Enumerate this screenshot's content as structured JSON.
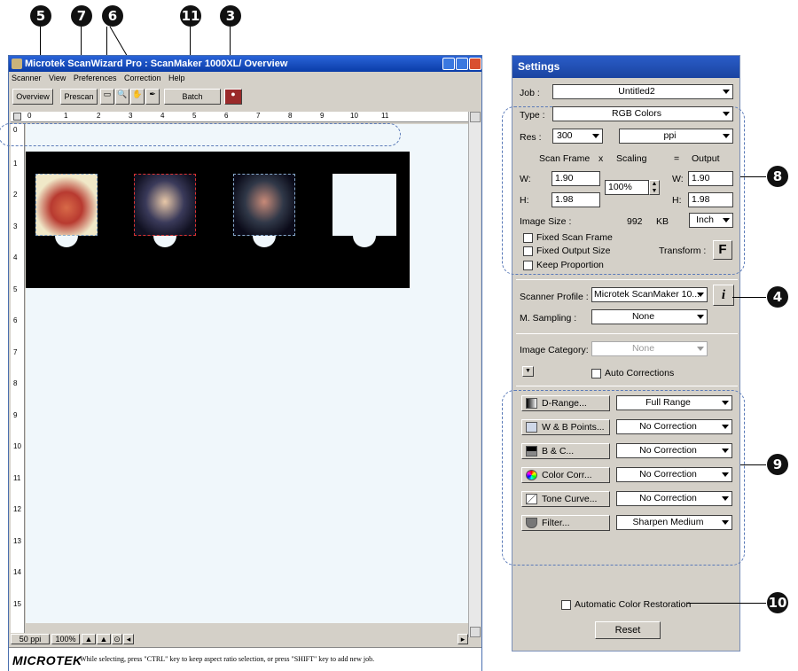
{
  "callouts": {
    "c5": "5",
    "c7": "7",
    "c6": "6",
    "c11": "11",
    "c3": "3",
    "c8": "8",
    "c4": "4",
    "c9": "9",
    "c10": "10"
  },
  "window": {
    "title": "Microtek ScanWizard Pro : ScanMaker 1000XL/ Overview",
    "menu": [
      "Scanner",
      "View",
      "Preferences",
      "Correction",
      "Help"
    ],
    "buttons": {
      "overview": "Overview",
      "prescan": "Prescan",
      "batch": "Batch"
    },
    "ruler_h": [
      "0",
      "1",
      "2",
      "3",
      "4",
      "5",
      "6",
      "7",
      "8",
      "9",
      "10",
      "11"
    ],
    "ruler_v": [
      "0",
      "1",
      "2",
      "3",
      "4",
      "5",
      "6",
      "7",
      "8",
      "9",
      "10",
      "11",
      "12",
      "13",
      "14",
      "15"
    ],
    "zoom": {
      "resolution": "50 ppi",
      "percent": "100%"
    },
    "logo": "MICROTEK",
    "status": "While selecting, press \"CTRL\" key to keep aspect ratio selection, or press \"SHIFT\" key to add new job."
  },
  "settings": {
    "title": "Settings",
    "job_label": "Job :",
    "job_value": "Untitled2",
    "type_label": "Type :",
    "type_value": "RGB Colors",
    "res_label": "Res :",
    "res_value": "300",
    "res_unit": "ppi",
    "scan_frame": "Scan Frame",
    "x": "x",
    "scaling": "Scaling",
    "eq": "=",
    "output": "Output",
    "w_label": "W:",
    "h_label": "H:",
    "sf_w": "1.90",
    "sf_h": "1.98",
    "scaling_value": "100%",
    "out_w": "1.90",
    "out_h": "1.98",
    "image_size_label": "Image Size :",
    "image_size_value": "992",
    "image_size_unit": "KB",
    "unit": "Inch",
    "fixed_scan_frame": "Fixed Scan Frame",
    "fixed_output_size": "Fixed Output Size",
    "keep_proportion": "Keep Proportion",
    "transform_label": "Transform :",
    "transform_btn": "F",
    "scanner_profile_label": "Scanner Profile :",
    "scanner_profile_value": "Microtek ScanMaker 10...",
    "info_btn": "i",
    "m_sampling_label": "M. Sampling :",
    "m_sampling_value": "None",
    "image_category_label": "Image Category:",
    "image_category_value": "None",
    "auto_corrections": "Auto Corrections",
    "tools": [
      {
        "label": "D-Range...",
        "value": "Full Range"
      },
      {
        "label": "W & B Points...",
        "value": "No Correction"
      },
      {
        "label": "B & C...",
        "value": "No Correction"
      },
      {
        "label": "Color Corr...",
        "value": "No Correction"
      },
      {
        "label": "Tone Curve...",
        "value": "No Correction"
      },
      {
        "label": "Filter...",
        "value": "Sharpen Medium"
      }
    ],
    "auto_color_restoration": "Automatic Color Restoration",
    "reset": "Reset"
  }
}
